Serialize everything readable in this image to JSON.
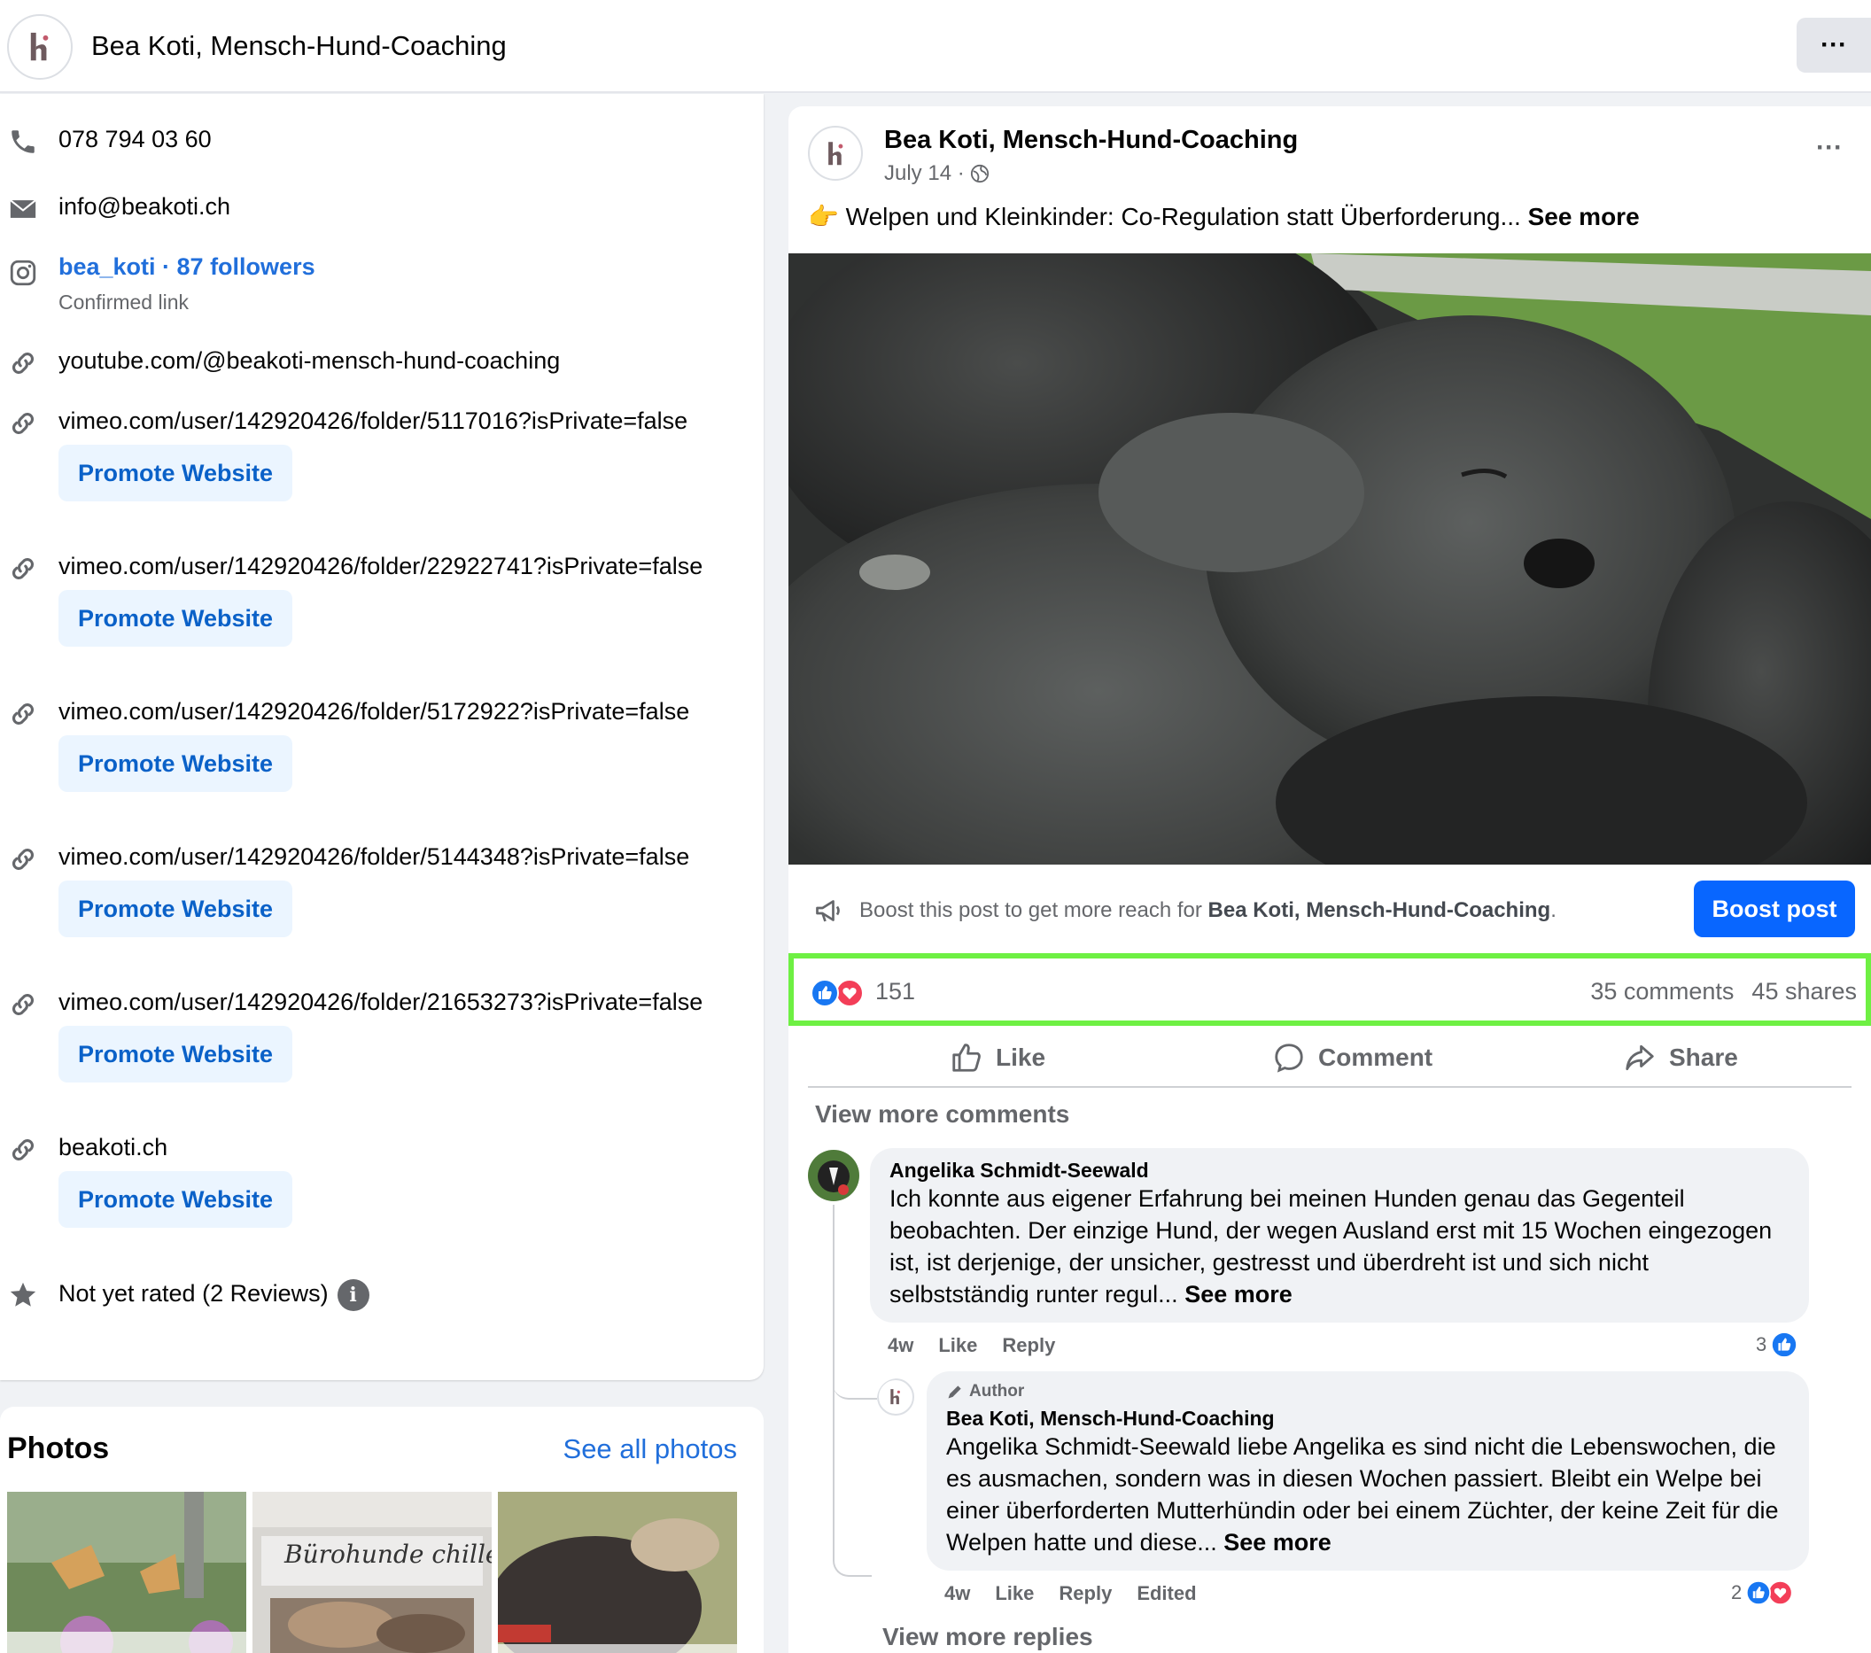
{
  "topbar": {
    "title": "Bea Koti, Mensch-Hund-Coaching",
    "more": "···"
  },
  "info": {
    "phone": "078 794 03 60",
    "email": "info@beakoti.ch",
    "instagram": "bea_koti · 87 followers",
    "instagram_sub": "Confirmed link",
    "links": [
      "youtube.com/@beakoti-mensch-hund-coaching",
      "vimeo.com/user/142920426/folder/5117016?isPrivate=false",
      "vimeo.com/user/142920426/folder/22922741?isPrivate=false",
      "vimeo.com/user/142920426/folder/5172922?isPrivate=false",
      "vimeo.com/user/142920426/folder/5144348?isPrivate=false",
      "vimeo.com/user/142920426/folder/21653273?isPrivate=false",
      "beakoti.ch"
    ],
    "promote_label": "Promote Website",
    "rating": "Not yet rated (2 Reviews)",
    "info_glyph": "i"
  },
  "photos": {
    "title": "Photos",
    "see_all": "See all photos",
    "captions": [
      "Bürohunde chillen..."
    ]
  },
  "post": {
    "author": "Bea Koti, Mensch-Hund-Coaching",
    "date": "July 14 ·",
    "emoji": "👉",
    "text": "Welpen und Kleinkinder: Co-Regulation statt Überforderung...",
    "see_more": "See more",
    "more": "···",
    "boost_prefix": "Boost this post to get more reach for",
    "boost_name": "Bea Koti, Mensch-Hund-Coaching",
    "boost_suffix": ".",
    "boost_button": "Boost post",
    "reaction_count": "151",
    "comments_count": "35 comments",
    "shares_count": "45 shares",
    "actions": {
      "like": "Like",
      "comment": "Comment",
      "share": "Share"
    },
    "view_more_comments": "View more comments"
  },
  "comments": [
    {
      "name": "Angelika Schmidt-Seewald",
      "text": "Ich konnte aus eigener Erfahrung bei meinen Hunden genau das Gegenteil beobachten. Der einzige Hund, der wegen Ausland erst mit 15 Wochen eingezogen ist, ist derjenige, der unsicher, gestresst und überdreht ist und sich nicht selbstständig runter regul...",
      "see_more": "See more",
      "time": "4w",
      "like": "Like",
      "reply": "Reply",
      "reactions": "3"
    }
  ],
  "reply": {
    "author_tag": "Author",
    "name": "Bea Koti, Mensch-Hund-Coaching",
    "text": "Angelika Schmidt-Seewald liebe Angelika es sind nicht die Lebenswochen, die es ausmachen, sondern was in diesen Wochen passiert. Bleibt ein Welpe bei einer überforderten Mutterhündin oder bei einem Züchter, der keine Zeit für die Welpen hatte und diese...",
    "see_more": "See more",
    "time": "4w",
    "like": "Like",
    "reply": "Reply",
    "edited": "Edited",
    "reactions": "2"
  },
  "view_more_replies": "View more replies",
  "colors": {
    "link": "#216fdb",
    "primary": "#0866ff",
    "highlight": "#6ef043",
    "like": "#1877f2",
    "love": "#f33e58"
  }
}
